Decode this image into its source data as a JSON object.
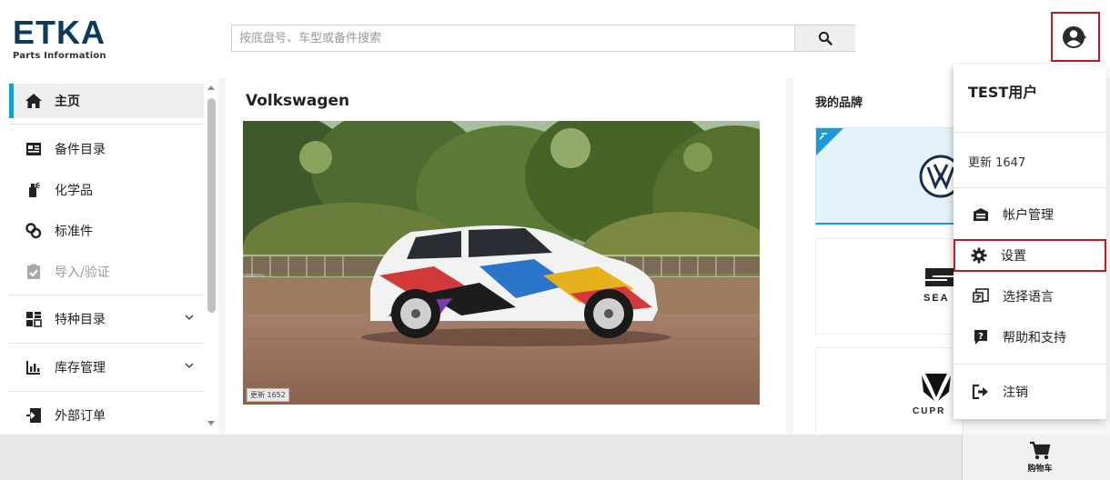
{
  "header": {
    "logo_main": "ETKA",
    "logo_sub": "Parts Information",
    "search_placeholder": "按底盘号、车型或备件搜索"
  },
  "sidebar": {
    "items": [
      {
        "label": "主页",
        "icon": "home-icon",
        "active": true
      },
      {
        "label": "备件目录",
        "icon": "catalog-icon"
      },
      {
        "label": "化学品",
        "icon": "chemical-icon"
      },
      {
        "label": "标准件",
        "icon": "standard-part-icon"
      },
      {
        "label": "导入/验证",
        "icon": "clipboard-check-icon",
        "disabled": true
      },
      {
        "label": "特种目录",
        "icon": "special-catalog-icon",
        "expandable": true
      },
      {
        "label": "库存管理",
        "icon": "bar-chart-icon",
        "expandable": true
      },
      {
        "label": "外部订单",
        "icon": "external-order-icon"
      }
    ]
  },
  "main": {
    "brand_title": "Volkswagen",
    "hero_badge": "更新 1652"
  },
  "brands": {
    "title": "我的品牌",
    "items": [
      "VW",
      "SEAT",
      "CUPRA"
    ]
  },
  "dropdown": {
    "user": "TEST用户",
    "update": "更新 1647",
    "items": [
      {
        "label": "帐户管理",
        "icon": "account-management-icon"
      },
      {
        "label": "设置",
        "icon": "gear-icon",
        "highlight": true
      },
      {
        "label": "选择语言",
        "icon": "language-icon"
      },
      {
        "label": "帮助和支持",
        "icon": "help-icon"
      },
      {
        "label": "注销",
        "icon": "logout-icon"
      }
    ]
  },
  "footer": {
    "cart_label": "购物车"
  },
  "colors": {
    "accent": "#1a9bd7",
    "highlight": "#b91c1c",
    "logo": "#0e3a5b"
  }
}
